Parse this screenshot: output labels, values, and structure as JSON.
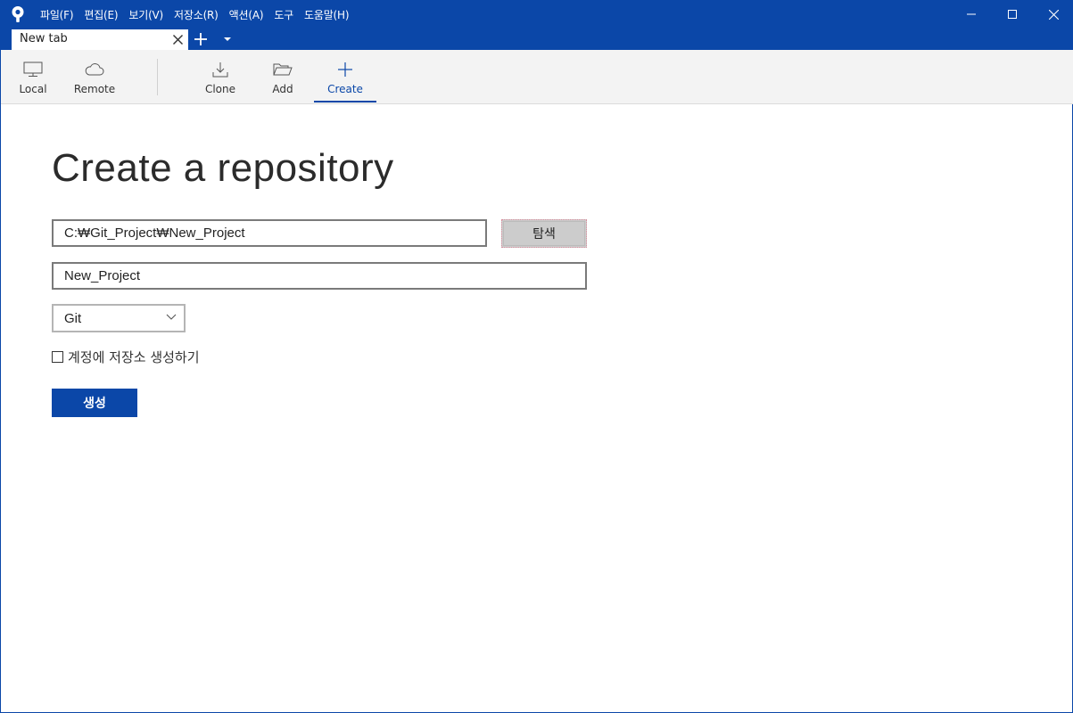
{
  "titlebar": {
    "menu": [
      {
        "label": "파일(F)"
      },
      {
        "label": "편집(E)"
      },
      {
        "label": "보기(V)"
      },
      {
        "label": "저장소(R)"
      },
      {
        "label": "액션(A)"
      },
      {
        "label": "도구"
      },
      {
        "label": "도움말(H)"
      }
    ],
    "accent_color": "#0b47a8"
  },
  "tabs": {
    "items": [
      {
        "label": "New tab"
      }
    ]
  },
  "toolbar": {
    "items": [
      {
        "label": "Local",
        "icon": "monitor-icon"
      },
      {
        "label": "Remote",
        "icon": "cloud-icon"
      },
      {
        "label": "Clone",
        "icon": "download-icon"
      },
      {
        "label": "Add",
        "icon": "folder-open-icon"
      },
      {
        "label": "Create",
        "icon": "plus-icon",
        "active": true
      }
    ]
  },
  "main": {
    "title": "Create a repository",
    "path_value": "C:₩Git_Project₩New_Project",
    "browse_label": "탐색",
    "name_value": "New_Project",
    "vcs_selected": "Git",
    "checkbox_label": "계정에 저장소 생성하기",
    "checkbox_checked": false,
    "create_label": "생성"
  }
}
